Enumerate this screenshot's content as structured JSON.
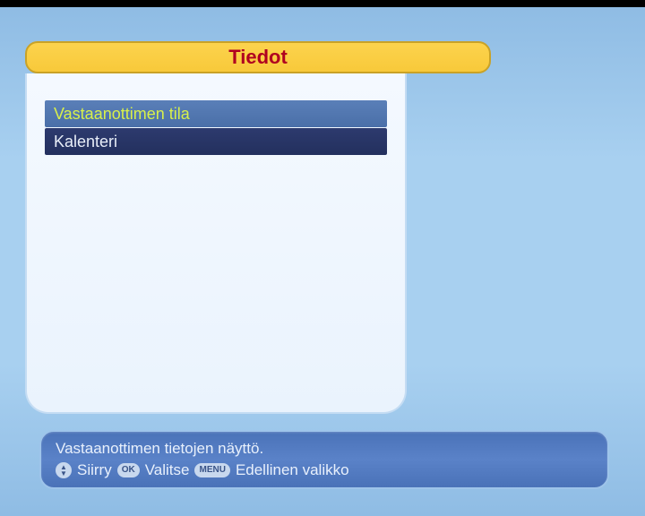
{
  "title": "Tiedot",
  "menu": {
    "items": [
      {
        "label": "Vastaanottimen tila",
        "selected": true
      },
      {
        "label": "Kalenteri",
        "selected": false
      }
    ]
  },
  "help": {
    "description": "Vastaanottimen tietojen näyttö.",
    "keys": {
      "move": "Siirry",
      "ok_badge": "OK",
      "select": "Valitse",
      "menu_badge": "MENU",
      "back": "Edellinen valikko"
    }
  }
}
